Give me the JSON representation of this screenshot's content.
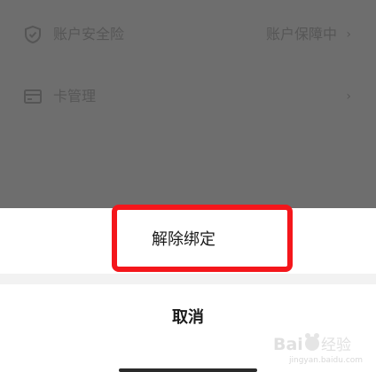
{
  "background_page": {
    "rows": [
      {
        "icon": "shield-icon",
        "label": "账户安全险",
        "value": "账户保障中",
        "chevron": "›"
      },
      {
        "icon": "card-icon",
        "label": "卡管理",
        "value": "",
        "chevron": "›"
      }
    ]
  },
  "action_sheet": {
    "unbind_label": "解除绑定",
    "cancel_label": "取消"
  },
  "watermark": {
    "text": "Baidu经验",
    "subtext": "jingyan.baidu.com"
  },
  "colors": {
    "overlay": "#6e6e6e",
    "highlight": "#f4161b",
    "separator": "#f2f2f2"
  }
}
